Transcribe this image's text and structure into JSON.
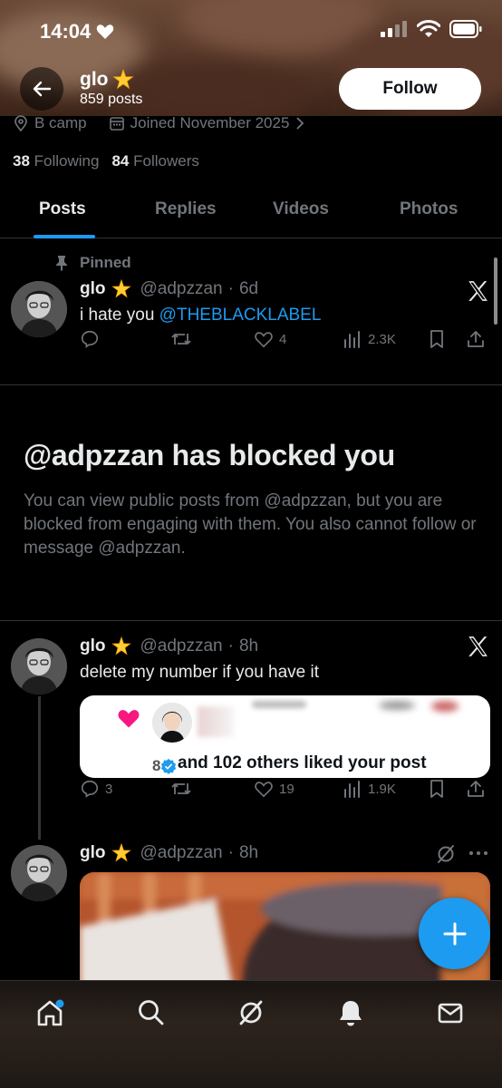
{
  "status_bar": {
    "time": "14:04"
  },
  "header": {
    "name": "glo",
    "posts": "859 posts",
    "follow_label": "Follow"
  },
  "profile": {
    "location": "B camp",
    "joined": "Joined November 2025",
    "following_count": "38",
    "following_label": "Following",
    "followers_count": "84",
    "followers_label": "Followers"
  },
  "tabs": [
    "Posts",
    "Replies",
    "Videos",
    "Photos"
  ],
  "pinned_post": {
    "pinned_label": "Pinned",
    "name": "glo",
    "handle": "@adpzzan",
    "sep": "·",
    "time": "6d",
    "text_prefix": "i hate you ",
    "mention": "@THEBLACKLABEL",
    "replies": "",
    "reposts": "",
    "likes": "4",
    "views": "2.3K"
  },
  "blocked": {
    "title": "@adpzzan has blocked you",
    "description": "You can view public posts from @adpzzan, but you are blocked from engaging with them. You also cannot follow or message @adpzzan."
  },
  "post2": {
    "name": "glo",
    "handle": "@adpzzan",
    "sep": "·",
    "time": "8h",
    "text": "delete my number if you have it",
    "card_prefix": "8",
    "card_caption": "and 102 others liked your post",
    "replies": "3",
    "likes": "19",
    "views": "1.9K"
  },
  "post3": {
    "name": "glo",
    "handle": "@adpzzan",
    "sep": "·",
    "time": "8h"
  },
  "colors": {
    "accent": "#1d9bf0",
    "background": "#000000",
    "muted": "#71767b",
    "like_pink": "#f91880"
  }
}
